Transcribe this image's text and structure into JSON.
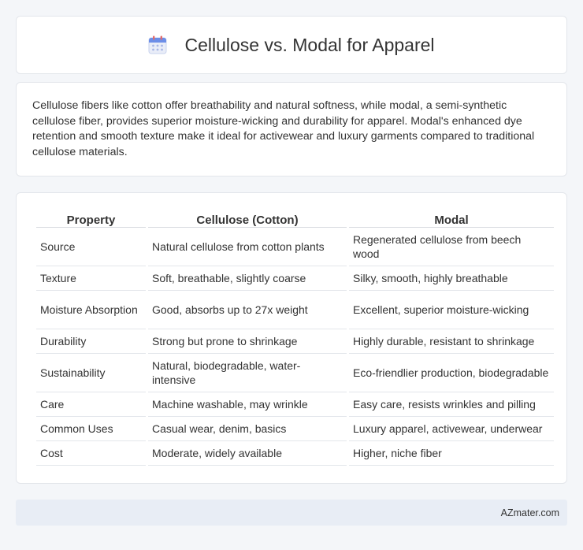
{
  "header": {
    "title": "Cellulose vs. Modal for Apparel",
    "icon": "calendar-icon",
    "icon_color": "#6c8ee8"
  },
  "description": "Cellulose fibers like cotton offer breathability and natural softness, while modal, a semi-synthetic cellulose fiber, provides superior moisture-wicking and durability for apparel. Modal's enhanced dye retention and smooth texture make it ideal for activewear and luxury garments compared to traditional cellulose materials.",
  "table": {
    "headers": [
      "Property",
      "Cellulose (Cotton)",
      "Modal"
    ],
    "rows": [
      [
        "Source",
        "Natural cellulose from cotton plants",
        "Regenerated cellulose from beech wood"
      ],
      [
        "Texture",
        "Soft, breathable, slightly coarse",
        "Silky, smooth, highly breathable"
      ],
      [
        "Moisture Absorption",
        "Good, absorbs up to 27x weight",
        "Excellent, superior moisture-wicking"
      ],
      [
        "Durability",
        "Strong but prone to shrinkage",
        "Highly durable, resistant to shrinkage"
      ],
      [
        "Sustainability",
        "Natural, biodegradable, water-intensive",
        "Eco-friendlier production, biodegradable"
      ],
      [
        "Care",
        "Machine washable, may wrinkle",
        "Easy care, resists wrinkles and pilling"
      ],
      [
        "Common Uses",
        "Casual wear, denim, basics",
        "Luxury apparel, activewear, underwear"
      ],
      [
        "Cost",
        "Moderate, widely available",
        "Higher, niche fiber"
      ]
    ]
  },
  "footer": {
    "brand": "AZmater.com"
  }
}
